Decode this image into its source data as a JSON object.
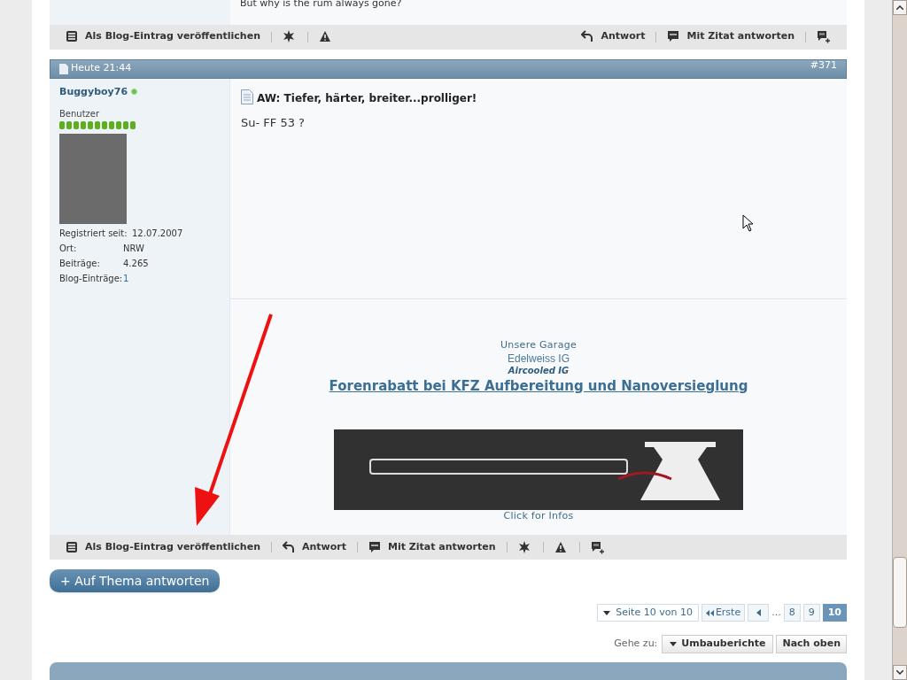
{
  "previous_post": {
    "text": "But why is the rum always gone?"
  },
  "postbars": [
    {
      "left": [
        {
          "kind": "blog",
          "label": "Als Blog-Eintrag veröffentlichen"
        },
        {
          "kind": "star"
        },
        {
          "kind": "warn"
        }
      ],
      "right": [
        {
          "kind": "reply",
          "label": "Antwort"
        },
        {
          "kind": "quote",
          "label": "Mit Zitat antworten"
        },
        {
          "kind": "multiquote"
        }
      ]
    },
    {
      "left": [
        {
          "kind": "blog",
          "label": "Als Blog-Eintrag veröffentlichen"
        },
        {
          "kind": "reply",
          "label": "Antwort"
        },
        {
          "kind": "quote",
          "label": "Mit Zitat antworten"
        },
        {
          "kind": "star"
        },
        {
          "kind": "warn"
        },
        {
          "kind": "multiquote"
        }
      ]
    }
  ],
  "post": {
    "date": "Heute 21:44",
    "number": "#371",
    "username": "Buggyboy76",
    "online": true,
    "rank": "Benutzer",
    "info": [
      {
        "label": "Registriert seit:",
        "value": "12.07.2007",
        "link": false
      },
      {
        "label": "Ort:",
        "value": "NRW",
        "link": false
      },
      {
        "label": "Beiträge:",
        "value": "4.265",
        "link": false
      },
      {
        "label": "Blog-Einträge:",
        "value": "1",
        "link": true
      }
    ],
    "title": "AW: Tiefer, härter, breiter...prolliger!",
    "message": "Su- FF 53 ?",
    "signature": [
      {
        "kind": "small",
        "text": "Unsere Garage"
      },
      {
        "kind": "plain",
        "text": "Edelweiss IG"
      },
      {
        "kind": "italic",
        "text": "Aircooled IG"
      },
      {
        "kind": "big_link",
        "text": "Forenrabatt bei KFZ Aufbereitung und Nanoversieglung"
      },
      {
        "kind": "banner"
      },
      {
        "kind": "small",
        "text": "Click for Infos"
      }
    ]
  },
  "reply_button": {
    "label": "+ Auf Thema antworten"
  },
  "pagination": {
    "summary": "Seite 10 von 10",
    "first": "Erste",
    "ellipsis": "...",
    "pages": [
      {
        "label": "8",
        "selected": false
      },
      {
        "label": "9",
        "selected": false
      },
      {
        "label": "10",
        "selected": true
      }
    ]
  },
  "goto": {
    "label": "Gehe zu:",
    "forum": "Umbauberichte",
    "top": "Nach oben"
  }
}
